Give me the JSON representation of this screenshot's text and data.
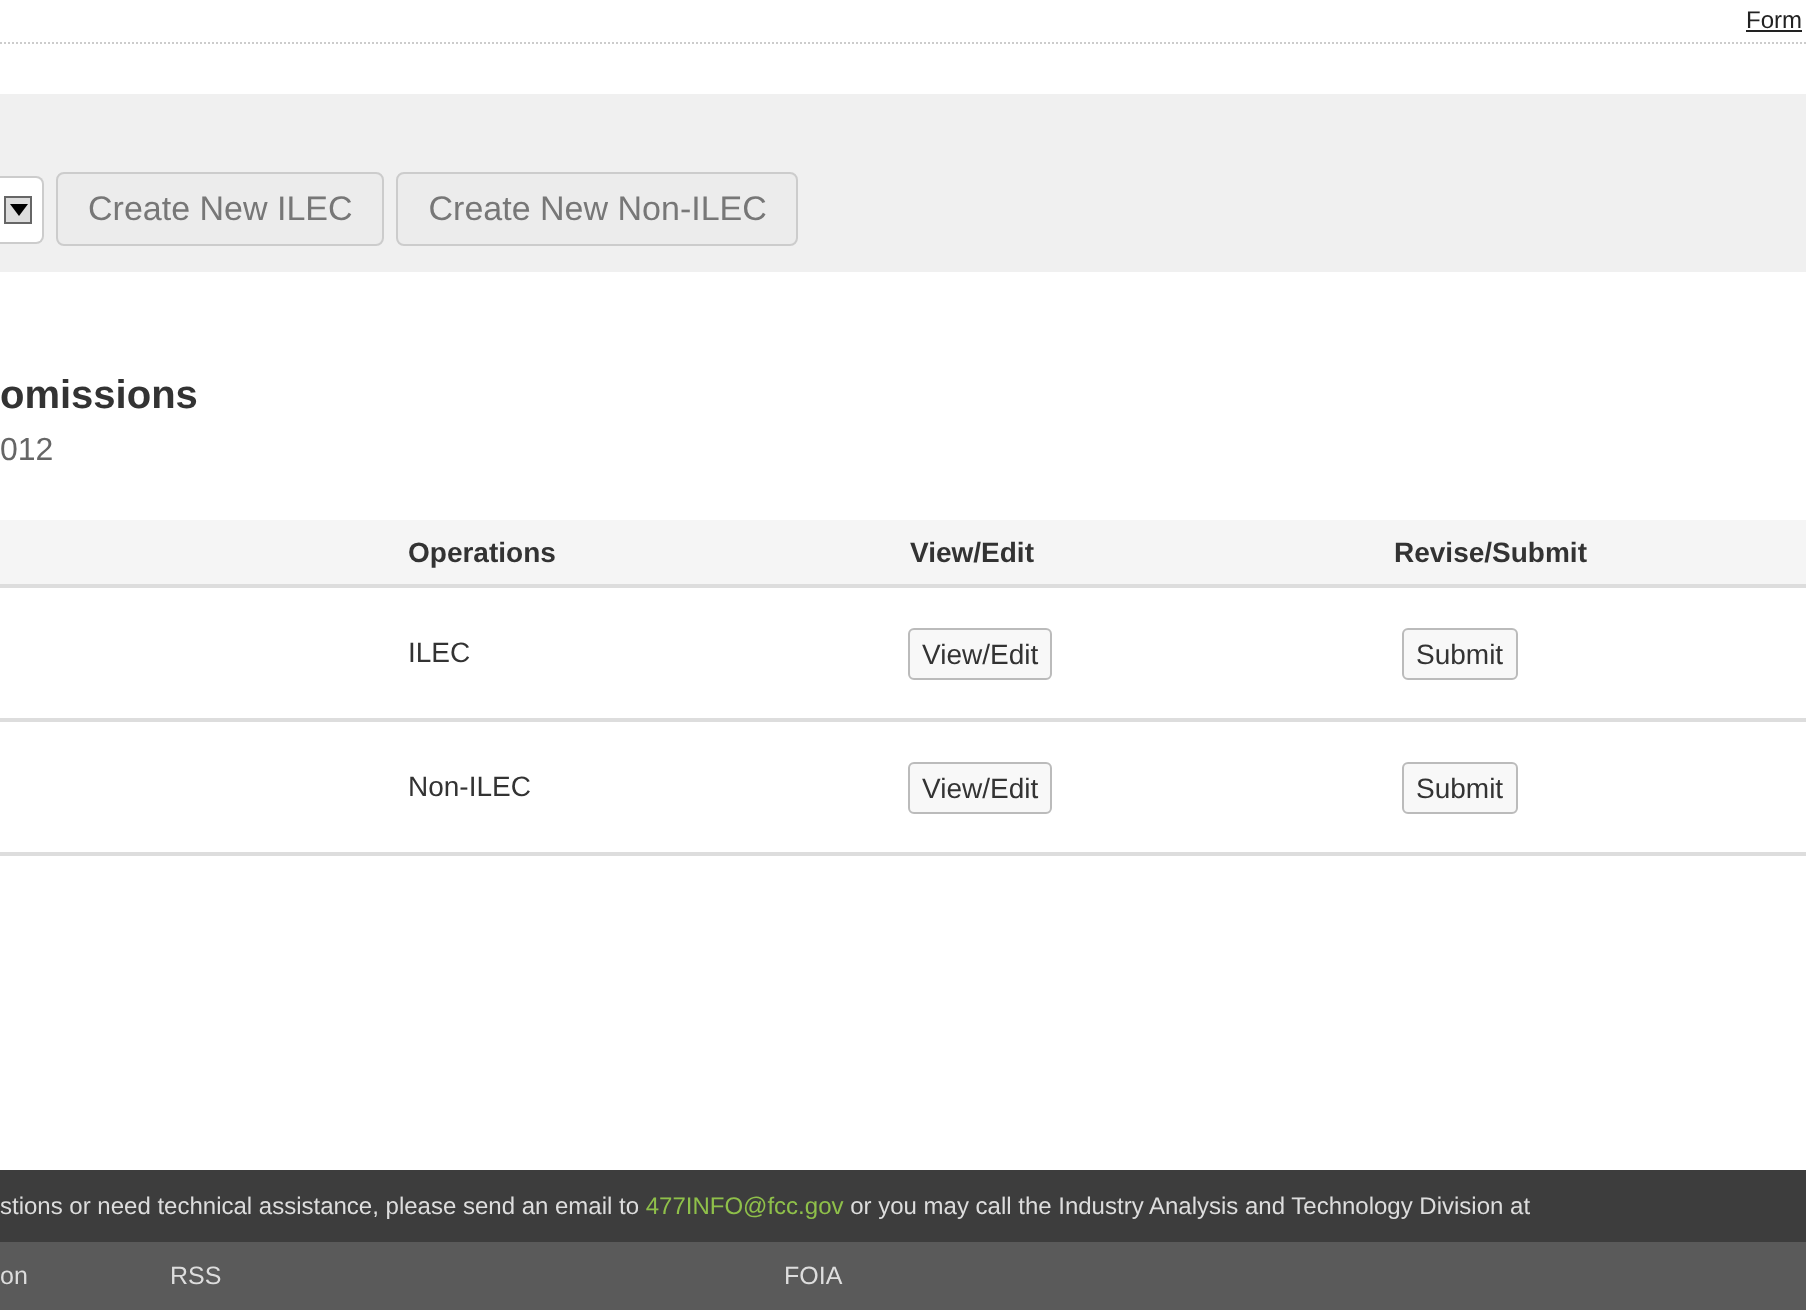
{
  "header": {
    "link": "Form"
  },
  "toolbar": {
    "buttons": [
      "Create New ILEC",
      "Create New Non-ILEC"
    ]
  },
  "heading": {
    "title": "omissions",
    "subtitle": "012"
  },
  "table": {
    "columns": [
      "Operations",
      "View/Edit",
      "Revise/Submit"
    ],
    "rows": [
      {
        "operations": "ILEC",
        "view_button": "View/Edit",
        "submit_button": "Submit"
      },
      {
        "operations": "Non-ILEC",
        "view_button": "View/Edit",
        "submit_button": "Submit"
      }
    ]
  },
  "footer": {
    "notice_before": "stions or need technical assistance, please send an email to",
    "email": "477INFO@fcc.gov",
    "notice_after": "or you may call the Industry Analysis and Technology Division at",
    "links": [
      "on",
      "RSS",
      "FOIA"
    ]
  }
}
